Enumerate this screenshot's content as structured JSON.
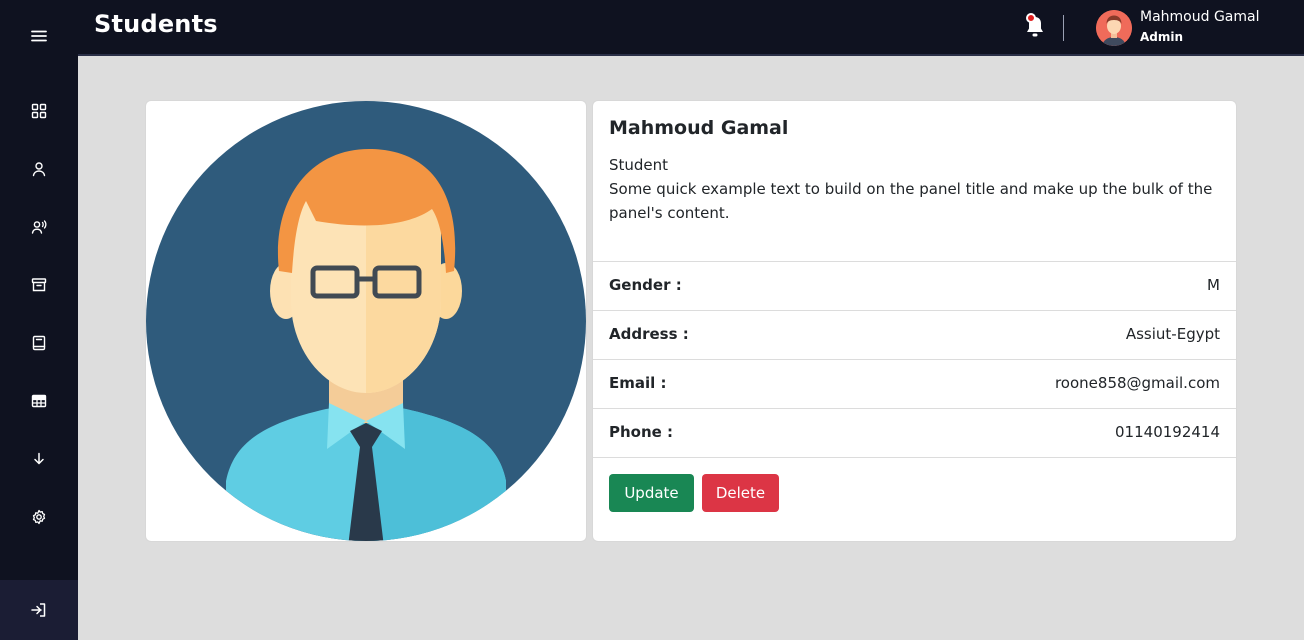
{
  "header": {
    "title": "Students",
    "user": {
      "name": "Mahmoud Gamal",
      "role": "Admin"
    }
  },
  "sidebar": {
    "items": [
      {
        "icon": "menu-icon"
      },
      {
        "icon": "dashboard-icon"
      },
      {
        "icon": "user-icon"
      },
      {
        "icon": "users-voice-icon"
      },
      {
        "icon": "archive-icon"
      },
      {
        "icon": "book-icon"
      },
      {
        "icon": "table-icon"
      },
      {
        "icon": "arrow-down-icon"
      },
      {
        "icon": "settings-icon"
      },
      {
        "icon": "logout-icon"
      }
    ]
  },
  "profile": {
    "name": "Mahmoud Gamal",
    "role": "Student",
    "description": "Some quick example text to build on the panel title and make up the bulk of the panel's content.",
    "fields": [
      {
        "label": "Gender :",
        "value": "M"
      },
      {
        "label": "Address :",
        "value": "Assiut-Egypt"
      },
      {
        "label": "Email :",
        "value": "roone858@gmail.com"
      },
      {
        "label": "Phone :",
        "value": "01140192414"
      }
    ],
    "actions": {
      "update_label": "Update",
      "delete_label": "Delete"
    }
  },
  "colors": {
    "sidebar_bg": "#0f1220",
    "update_button": "#198754",
    "delete_button": "#dc3545",
    "notification_dot": "#e02020"
  }
}
